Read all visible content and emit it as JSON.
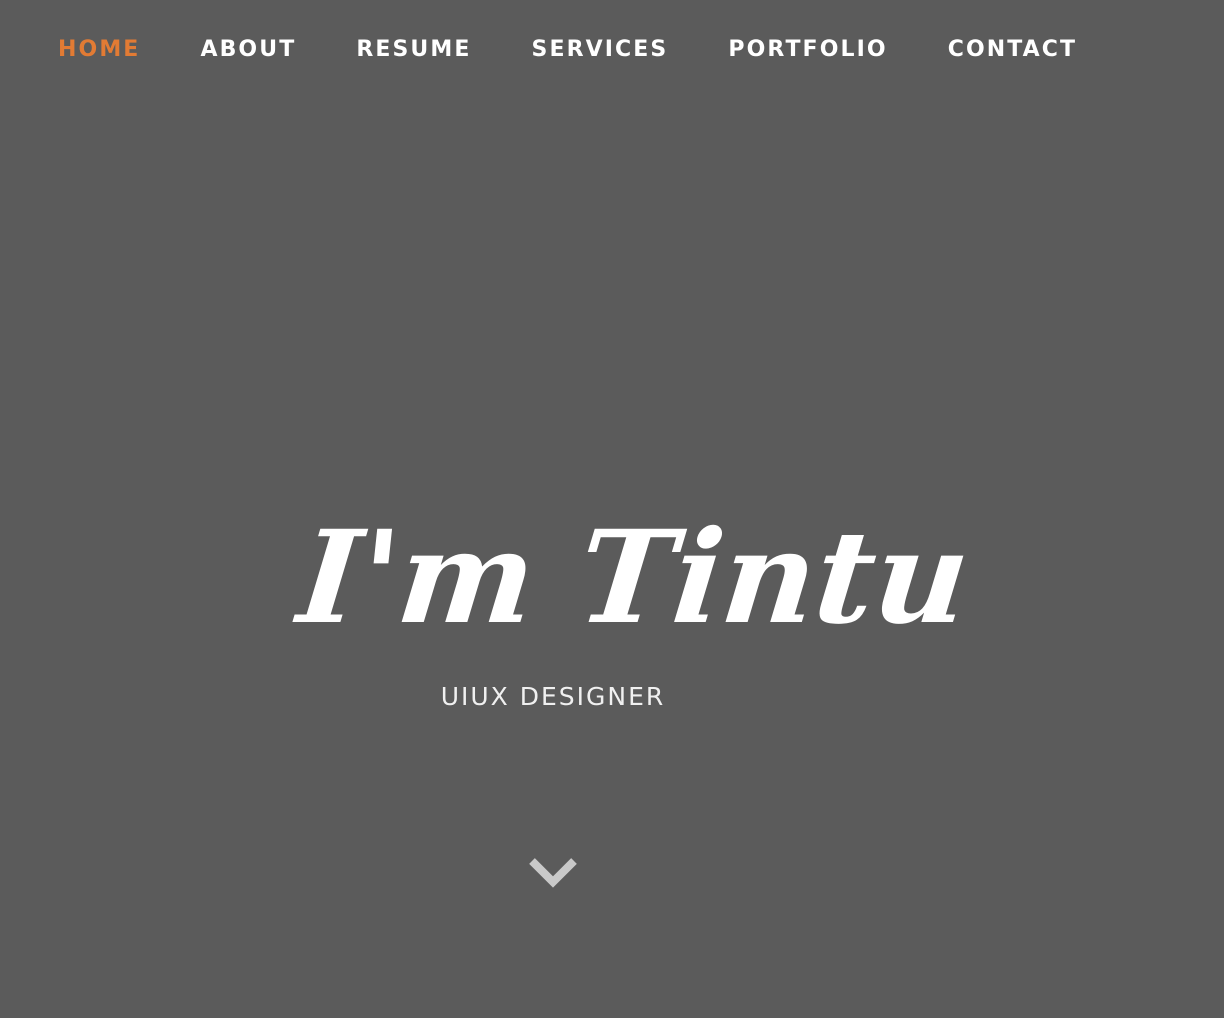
{
  "nav": {
    "items": [
      {
        "label": "HOME",
        "active": true
      },
      {
        "label": "ABOUT",
        "active": false
      },
      {
        "label": "RESUME",
        "active": false
      },
      {
        "label": "SERVICES",
        "active": false
      },
      {
        "label": "PORTFOLIO",
        "active": false
      },
      {
        "label": "CONTACT",
        "active": false
      }
    ]
  },
  "hero": {
    "name": "I'm Tintu",
    "role": "UIUX DESIGNER",
    "scroll_icon": "chevron-down-icon"
  },
  "colors": {
    "background": "#5b5b5b",
    "accent": "#e27b34",
    "text": "#ffffff",
    "icon": "#c9c9c9"
  }
}
